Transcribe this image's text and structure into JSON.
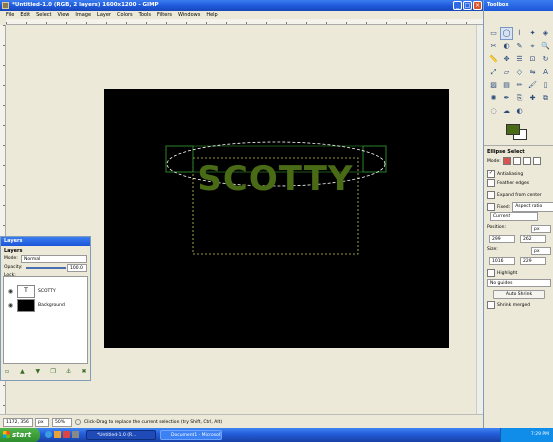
{
  "window": {
    "title": "*Untitled-1.0 (RGB, 2 layers) 1600x1200 - GIMP",
    "controls": {
      "minimize": "_",
      "maximize": "□",
      "close": "×"
    }
  },
  "menu": [
    "File",
    "Edit",
    "Select",
    "View",
    "Image",
    "Layer",
    "Colors",
    "Tools",
    "Filters",
    "Windows",
    "Help"
  ],
  "canvas": {
    "text": "SCOTTY",
    "text_color": "#4a6b16",
    "background_color": "#000000"
  },
  "status": {
    "coords": "1172, 356",
    "unit": "px",
    "zoom": "50%",
    "message": "Click-Drag to replace the current selection (try Shift, Ctrl, Alt)"
  },
  "toolbox": {
    "title": "Toolbox",
    "tools": [
      "rect-select",
      "ellipse-select",
      "free-select",
      "fuzzy-select",
      "select-by-color",
      "scissors",
      "foreground-select",
      "paths",
      "color-picker",
      "zoom",
      "measure",
      "move",
      "align",
      "crop",
      "rotate",
      "scale",
      "shear",
      "perspective",
      "flip",
      "text",
      "bucket-fill",
      "blend",
      "pencil",
      "paintbrush",
      "eraser",
      "airbrush",
      "ink",
      "clone",
      "heal",
      "perspective-clone",
      "convolve",
      "smudge",
      "dodge-burn"
    ],
    "fg_color": "#4a6b16",
    "bg_color": "#ffffff"
  },
  "tool_options": {
    "title": "Ellipse Select",
    "mode_label": "Mode:",
    "antialiasing": "Antialiasing",
    "feather": "Feather edges",
    "expand": "Expand from center",
    "fixed": "Fixed:",
    "fixed_value": "Aspect ratio",
    "current": "Current",
    "position_label": "Position:",
    "position_unit": "px",
    "pos_x": "299",
    "pos_y": "262",
    "size_label": "Size:",
    "size_unit": "px",
    "size_w": "1016",
    "size_h": "229",
    "highlight": "Highlight",
    "guides": "No guides",
    "auto_shrink": "Auto Shrink",
    "shrink_merged": "Shrink merged"
  },
  "layers": {
    "dock_title": "Layers",
    "title": "Layers",
    "mode_label": "Mode:",
    "mode_value": "Normal",
    "opacity_label": "Opacity:",
    "opacity_value": "100.0",
    "lock_label": "Lock:",
    "items": [
      {
        "name": "SCOTTY"
      },
      {
        "name": "Background"
      }
    ]
  },
  "taskbar": {
    "start": "start",
    "tasks": [
      "*Untitled-1.0 (R...",
      "Document1 - Microsof..."
    ],
    "time": "7:29 PM"
  }
}
